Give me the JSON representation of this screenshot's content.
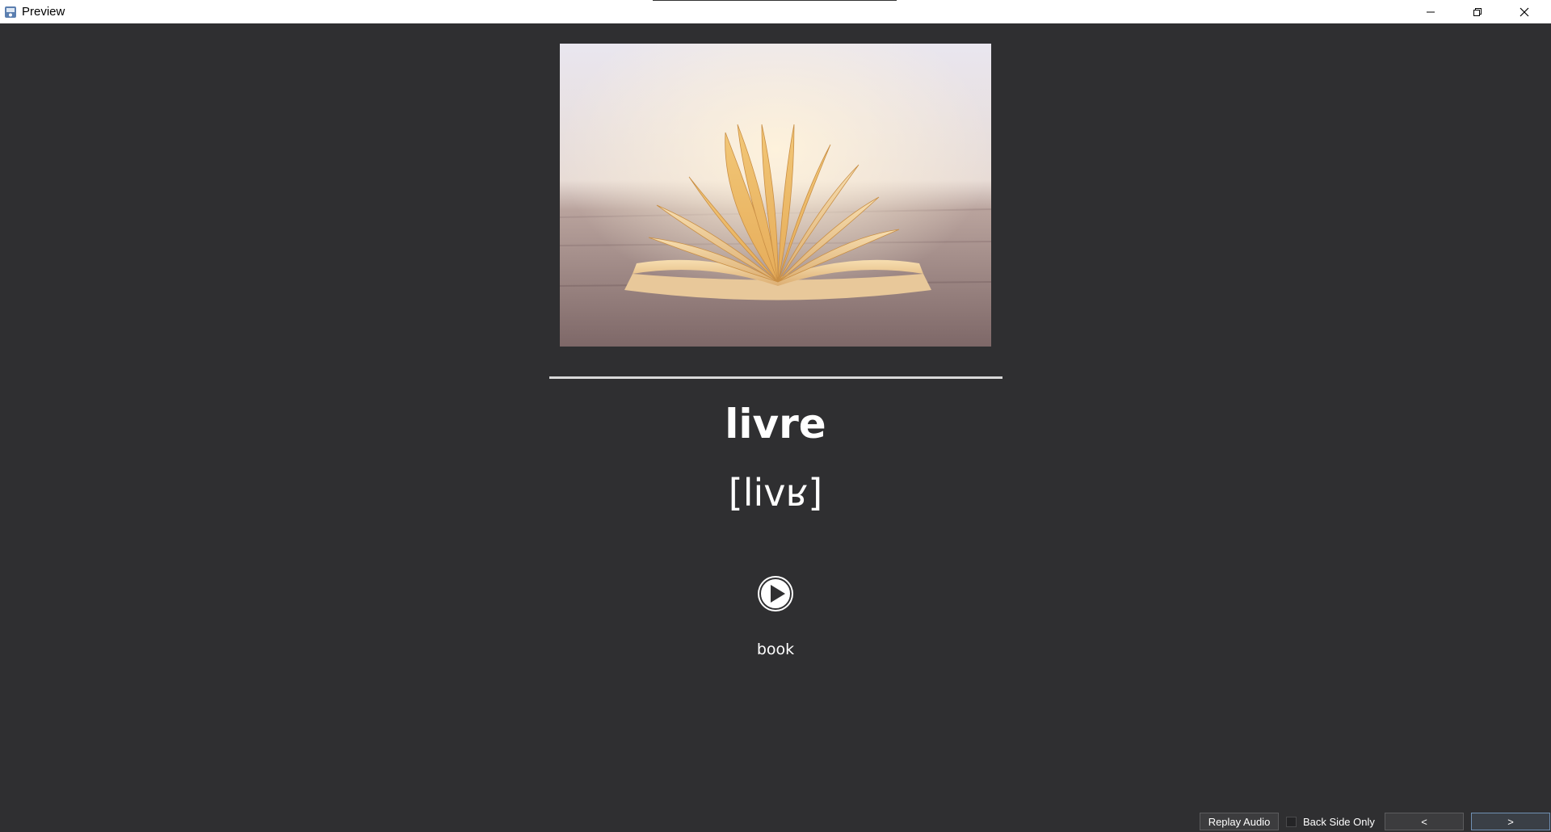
{
  "window": {
    "title": "Preview",
    "icon": "app-icon"
  },
  "card": {
    "image": {
      "subject": "open book on wooden table",
      "icon": "photo-image"
    },
    "word": "livre",
    "ipa": "[livʁ]",
    "play_icon": "play-circle-icon",
    "meaning": "book"
  },
  "controls": {
    "replay_label": "Replay Audio",
    "back_side_only_label": "Back Side Only",
    "back_side_only_checked": false,
    "prev_label": "<",
    "next_label": ">"
  },
  "colors": {
    "background": "#2f2f31",
    "titlebar": "#ffffff",
    "text": "#ffffff",
    "divider": "#d9d9d9"
  }
}
